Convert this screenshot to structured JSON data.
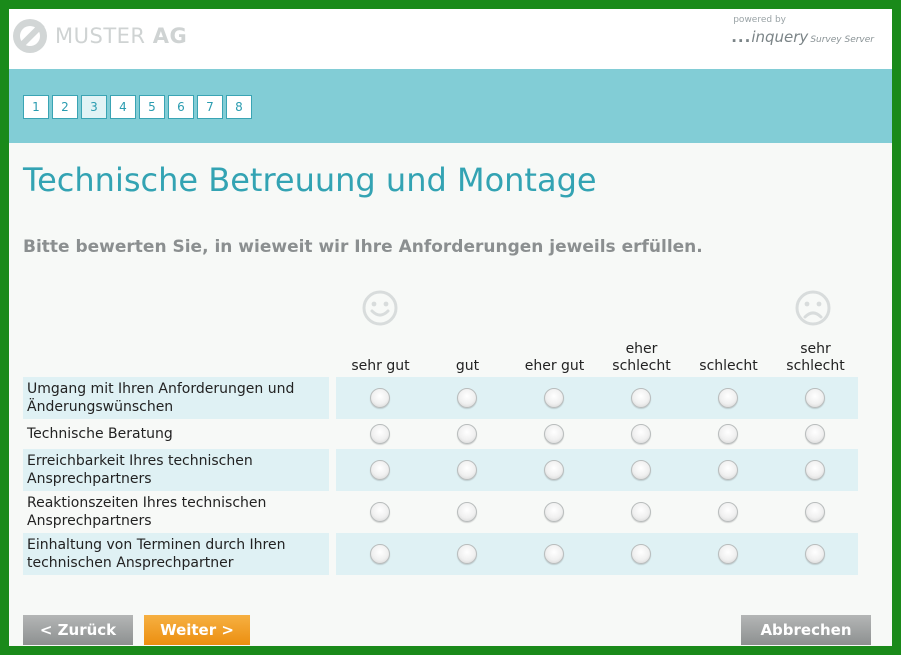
{
  "header": {
    "logo_text": "MUSTER",
    "logo_text_bold": "AG",
    "powered_by": "powered by",
    "brand_dots": "...",
    "brand_name": "inquery",
    "brand_sub": "Survey Server"
  },
  "progress": {
    "pages": [
      "1",
      "2",
      "3",
      "4",
      "5",
      "6",
      "7",
      "8"
    ],
    "current": 3
  },
  "main": {
    "title": "Technische Betreuung und Montage",
    "instruction": "Bitte bewerten Sie, in wieweit wir Ihre Anforderungen jeweils erfüllen."
  },
  "scale": {
    "columns": [
      {
        "line1": "",
        "line2": "sehr gut"
      },
      {
        "line1": "",
        "line2": "gut"
      },
      {
        "line1": "",
        "line2": "eher gut"
      },
      {
        "line1": "eher",
        "line2": "schlecht"
      },
      {
        "line1": "",
        "line2": "schlecht"
      },
      {
        "line1": "sehr",
        "line2": "schlecht"
      }
    ],
    "left_icon": "happy-smiley-icon",
    "right_icon": "sad-smiley-icon"
  },
  "items": [
    {
      "line1": "Umgang mit Ihren Anforderungen und",
      "line2": "Änderungswünschen"
    },
    {
      "line1": "Technische Beratung",
      "line2": ""
    },
    {
      "line1": "Erreichbarkeit Ihres technischen",
      "line2": "Ansprechpartners"
    },
    {
      "line1": "Reaktionszeiten Ihres technischen",
      "line2": "Ansprechpartners"
    },
    {
      "line1": "Einhaltung von Terminen durch Ihren",
      "line2": "technischen Ansprechpartner"
    }
  ],
  "nav": {
    "back": "< Zurück",
    "next": "Weiter >",
    "cancel": "Abbrechen"
  },
  "colors": {
    "accent": "#33a3b3",
    "band": "#82cdd6",
    "next_button": "#ec8f10",
    "grey_button": "#8d9090",
    "frame": "#1a8a1a"
  }
}
